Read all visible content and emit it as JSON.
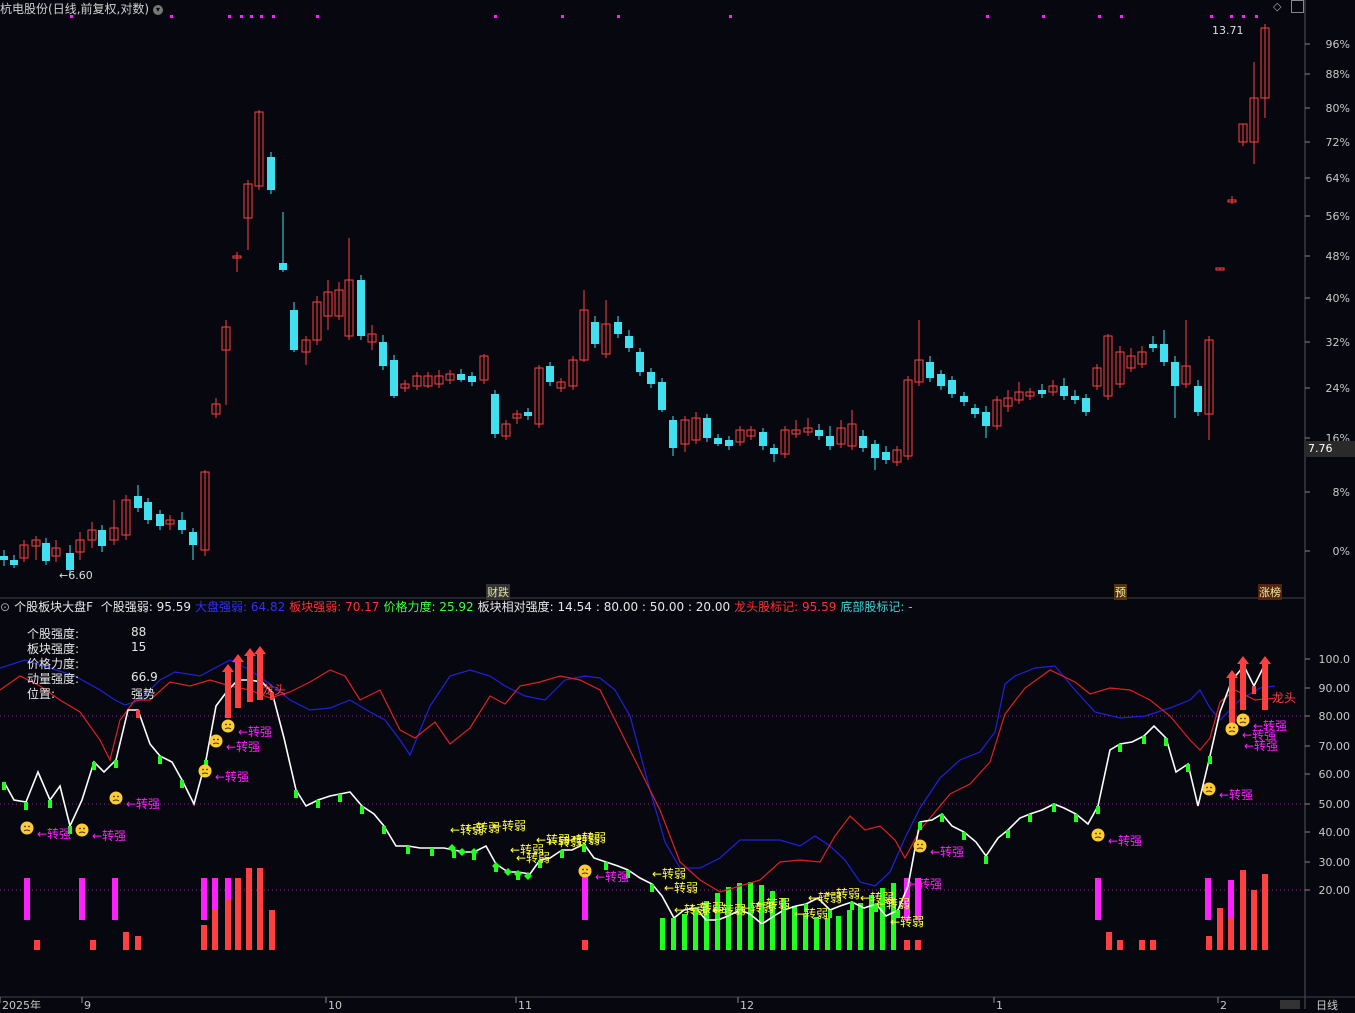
{
  "header": {
    "title": "杭电股份",
    "mode": "(日线,前复权,对数)"
  },
  "main_axis": {
    "labels": [
      "96%",
      "88%",
      "80%",
      "72%",
      "64%",
      "56%",
      "48%",
      "40%",
      "32%",
      "24%",
      "16%",
      "8%",
      "0%"
    ],
    "current_price": "7.76",
    "high_marker": "13.71",
    "low_marker": "←6.60"
  },
  "events": {
    "caidie": "财跌",
    "yu": "预",
    "zhangbang": "涨榜"
  },
  "indicator": {
    "name": "个股板块大盘F",
    "items": [
      {
        "label": "个股强弱:",
        "value": "95.59",
        "color": "#e6e6e6"
      },
      {
        "label": "大盘强弱:",
        "value": "64.82",
        "color": "#3030ff"
      },
      {
        "label": "板块强弱:",
        "value": "70.17",
        "color": "#ff3030"
      },
      {
        "label": "价格力度:",
        "value": "25.92",
        "color": "#40ff40"
      },
      {
        "label": "板块相对强度:",
        "value": "14.54",
        "color": "#e6e6e6"
      },
      {
        "label": "",
        "value": ": 80.00 : 50.00 : 20.00",
        "color": "#e6e6e6"
      },
      {
        "label": "龙头股标记:",
        "value": "95.59",
        "color": "#ff3030"
      },
      {
        "label": "底部股标记:",
        "value": "-",
        "color": "#40d0d0"
      }
    ],
    "axis_labels": [
      "100.0",
      "90.00",
      "80.00",
      "70.00",
      "60.00",
      "50.00",
      "40.00",
      "30.00",
      "20.00"
    ],
    "stats": [
      {
        "label": "个股强度:",
        "value": "88"
      },
      {
        "label": "板块强度:",
        "value": "15"
      },
      {
        "label": "价格力度:",
        "value": ""
      },
      {
        "label": "动量强度:",
        "value": "66.9"
      },
      {
        "label": "位置:",
        "value": "强势"
      }
    ],
    "annotations": {
      "strong": "←转强",
      "weak": "←转弱",
      "leader": "龙头"
    }
  },
  "x_axis": {
    "labels": [
      "2025年",
      "9",
      "10",
      "11",
      "12",
      "1",
      "2"
    ],
    "period": "日线"
  },
  "colors": {
    "background": "#07070f",
    "up": "#ff4040",
    "down": "#40e0f0",
    "stock_line": "#ffffff",
    "market_line": "#2020e0",
    "sector_line": "#e02020",
    "magenta": "#ff20ff",
    "green": "#20ff20",
    "yellow": "#ffff40"
  },
  "chart_data": [
    {
      "type": "candlestick",
      "title": "杭电股份 (日线,前复权,对数)",
      "y_axis": "percent change, log scale",
      "ylim": [
        0,
        96
      ],
      "annotations": {
        "high": 13.71,
        "low": 6.6,
        "last": 7.76
      }
    },
    {
      "type": "line",
      "title": "个股板块大盘F",
      "ylim": [
        20,
        100
      ],
      "series": [
        {
          "name": "个股强弱",
          "last": 95.59
        },
        {
          "name": "大盘强弱",
          "last": 64.82
        },
        {
          "name": "板块强弱",
          "last": 70.17
        },
        {
          "name": "价格力度",
          "last": 25.92
        }
      ]
    }
  ]
}
